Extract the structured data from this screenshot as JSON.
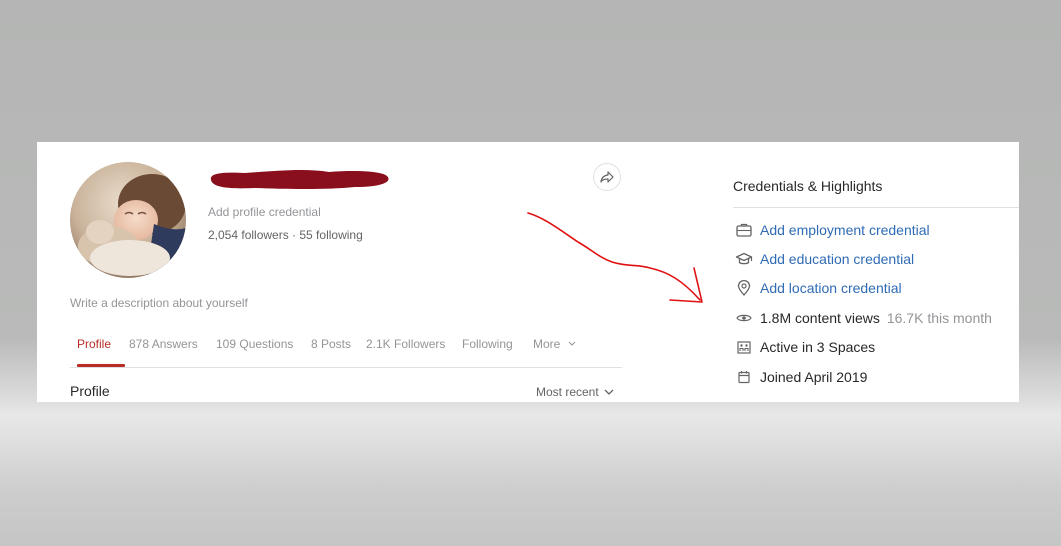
{
  "profile": {
    "credential_placeholder": "Add profile credential",
    "stats": "2,054 followers · 55 following",
    "description_placeholder": "Write a description about yourself"
  },
  "tabs": [
    {
      "label": "Profile",
      "active": true
    },
    {
      "label": "878 Answers"
    },
    {
      "label": "109 Questions"
    },
    {
      "label": "8 Posts"
    },
    {
      "label": "2.1K Followers"
    },
    {
      "label": "Following"
    },
    {
      "label": "More"
    }
  ],
  "main": {
    "section_title": "Profile",
    "sort_label": "Most recent"
  },
  "credentials": {
    "title": "Credentials & Highlights",
    "employment": "Add employment credential",
    "education": "Add education credential",
    "location": "Add location credential",
    "views": "1.8M content views",
    "views_month": "16.7K this month",
    "spaces": "Active in 3 Spaces",
    "joined": "Joined April 2019"
  },
  "icons": {
    "share": "share-arrow-icon",
    "chevron": "chevron-down-icon",
    "employment": "briefcase-icon",
    "education": "graduation-cap-icon",
    "location": "location-pin-icon",
    "views": "eye-icon",
    "spaces": "spaces-icon",
    "joined": "calendar-icon"
  },
  "colors": {
    "accent_red": "#b92b27",
    "link_blue": "#2f6bb5",
    "redaction": "#8a0f1c",
    "annotation_arrow": "#e01010"
  }
}
